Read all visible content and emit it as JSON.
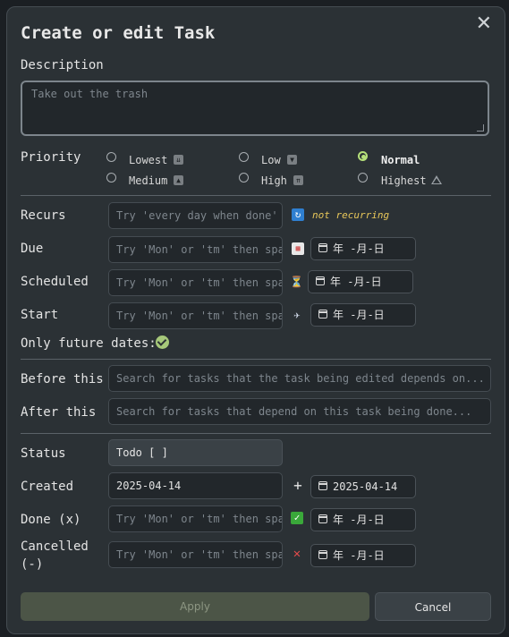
{
  "title": "Create or edit Task",
  "close_glyph": "✕",
  "description": {
    "label": "Description",
    "placeholder": "Take out the trash"
  },
  "priority": {
    "label": "Priority",
    "options": [
      {
        "label": "Lowest",
        "icon": "⏬",
        "selected": false
      },
      {
        "label": "Low",
        "icon": "🔽",
        "selected": false
      },
      {
        "label": "Normal",
        "icon": "",
        "selected": true
      },
      {
        "label": "Medium",
        "icon": "🔼",
        "selected": false
      },
      {
        "label": "High",
        "icon": "⏫",
        "selected": false
      },
      {
        "label": "Highest",
        "icon": "🔺",
        "selected": false
      }
    ]
  },
  "recurs": {
    "label": "Recurs",
    "placeholder": "Try 'every day when done'",
    "icon": "🔁",
    "status": "not recurring"
  },
  "due": {
    "label": "Due",
    "placeholder": "Try 'Mon' or 'tm' then space",
    "icon": "📅",
    "date": "年 -月-日"
  },
  "scheduled": {
    "label": "Scheduled",
    "placeholder": "Try 'Mon' or 'tm' then space",
    "icon": "⏳",
    "date": "年 -月-日"
  },
  "start": {
    "label": "Start",
    "placeholder": "Try 'Mon' or 'tm' then space",
    "icon": "🛫",
    "date": "年 -月-日"
  },
  "only_future": {
    "label": "Only future dates:",
    "checked": true
  },
  "before_this": {
    "label": "Before this",
    "placeholder": "Search for tasks that the task being edited depends on..."
  },
  "after_this": {
    "label": "After this",
    "placeholder": "Search for tasks that depend on this task being done..."
  },
  "status": {
    "label": "Status",
    "value": "Todo [ ]"
  },
  "created": {
    "label": "Created",
    "value": "2025-04-14",
    "icon": "➕",
    "date": "2025-04-14"
  },
  "done": {
    "label": "Done (x)",
    "placeholder": "Try 'Mon' or 'tm' then space",
    "icon": "✅",
    "date": "年 -月-日"
  },
  "cancelled": {
    "label": "Cancelled",
    "label2": "(-)",
    "placeholder": "Try 'Mon' or 'tm' then space",
    "icon": "❌",
    "date": "年 -月-日"
  },
  "buttons": {
    "apply": "Apply",
    "cancel": "Cancel"
  },
  "colors": {
    "accent": "#b5e07a",
    "apply_bg": "#4c5547",
    "panel": "#2b3135"
  }
}
